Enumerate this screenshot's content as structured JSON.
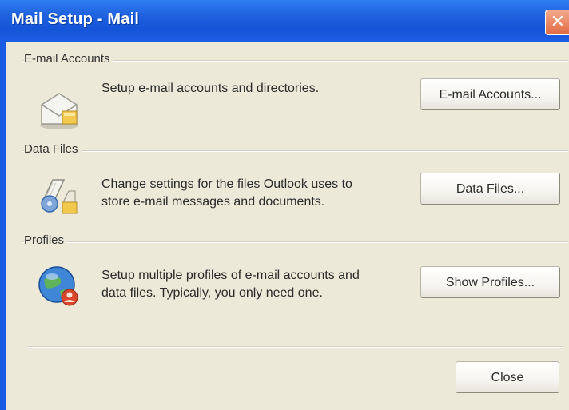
{
  "window": {
    "title": "Mail Setup - Mail",
    "close_glyph": "✕"
  },
  "sections": {
    "email": {
      "heading": "E-mail Accounts",
      "description": "Setup e-mail accounts and directories.",
      "button_label": "E-mail Accounts...",
      "icon": "email-accounts-icon"
    },
    "data_files": {
      "heading": "Data Files",
      "description_line1": "Change settings for the files Outlook uses to",
      "description_line2": "store e-mail messages and documents.",
      "button_label": "Data Files...",
      "icon": "data-files-icon"
    },
    "profiles": {
      "heading": "Profiles",
      "description_line1": "Setup multiple profiles of e-mail accounts and",
      "description_line2": "data files. Typically, you only need one.",
      "button_label": "Show Profiles...",
      "icon": "profiles-icon"
    }
  },
  "footer": {
    "close_label": "Close"
  },
  "colors": {
    "titlebar": "#1f63e0",
    "dialog_background": "#ece9d8",
    "close_button": "#e06a43"
  }
}
